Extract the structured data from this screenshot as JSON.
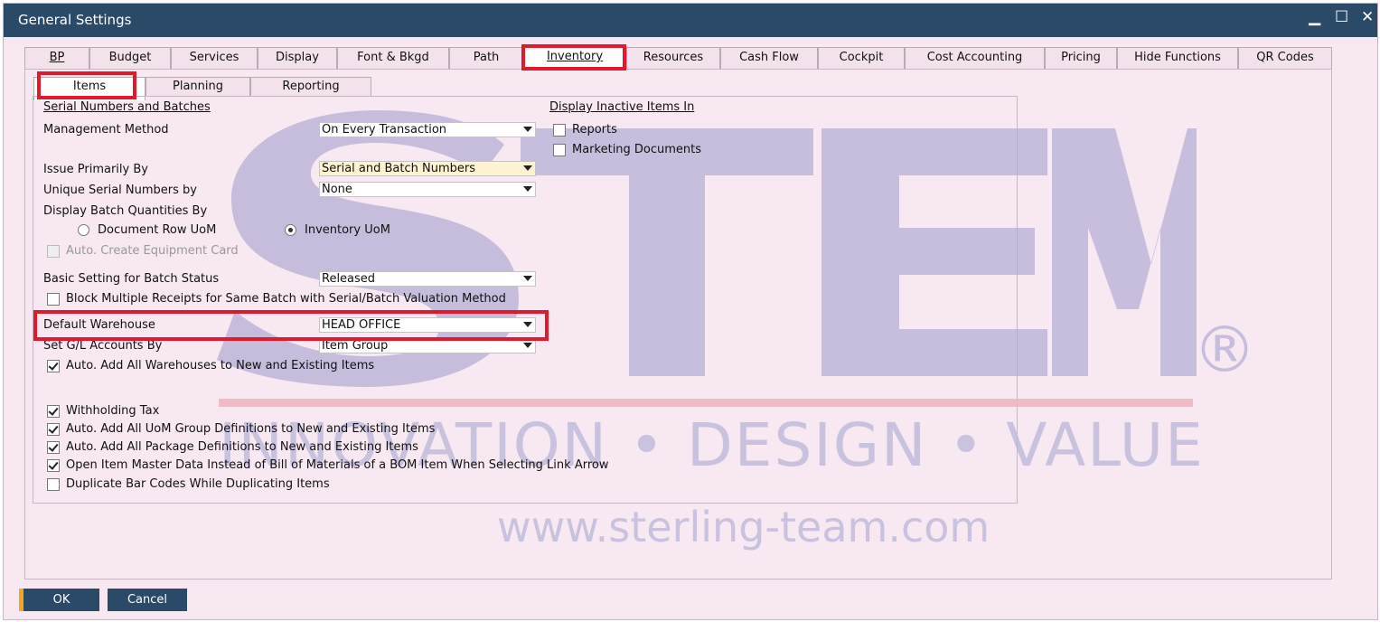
{
  "window": {
    "title": "General Settings",
    "minimize": "▁",
    "maximize": "☐",
    "close": "✕"
  },
  "main_tabs": [
    "BP",
    "Budget",
    "Services",
    "Display",
    "Font & Bkgd",
    "Path",
    "Inventory",
    "Resources",
    "Cash Flow",
    "Cockpit",
    "Cost Accounting",
    "Pricing",
    "Hide Functions",
    "QR Codes"
  ],
  "active_main_tab": "Inventory",
  "sub_tabs": [
    "Items",
    "Planning",
    "Reporting"
  ],
  "active_sub_tab": "Items",
  "items": {
    "serial_section": "Serial Numbers and Batches",
    "management_method_label": "Management Method",
    "management_method_value": "On Every Transaction",
    "issue_primarily_label": "Issue Primarily By",
    "issue_primarily_value": "Serial and Batch Numbers",
    "unique_serial_label": "Unique Serial Numbers by",
    "unique_serial_value": "None",
    "display_batch_label": "Display Batch Quantities By",
    "radio_doc_row": "Document Row UoM",
    "radio_inventory": "Inventory UoM",
    "auto_equipment": "Auto. Create Equipment Card",
    "basic_batch_label": "Basic Setting for Batch Status",
    "basic_batch_value": "Released",
    "block_multiple": "Block Multiple Receipts for Same Batch with Serial/Batch Valuation Method",
    "default_wh_label": "Default Warehouse",
    "default_wh_value": "HEAD OFFICE",
    "set_gl_label": "Set G/L Accounts By",
    "set_gl_value": "Item Group",
    "auto_add_wh": "Auto. Add All Warehouses to New and Existing Items",
    "withholding": "Withholding Tax",
    "auto_uom": "Auto. Add All UoM Group Definitions to New and Existing Items",
    "auto_pkg": "Auto. Add All Package Definitions to New and Existing Items",
    "open_item_master": "Open Item Master Data Instead of Bill of Materials of a BOM Item When Selecting Link Arrow",
    "dup_barcodes": "Duplicate Bar Codes While Duplicating Items",
    "inactive_section": "Display Inactive Items In",
    "reports": "Reports",
    "marketing_docs": "Marketing Documents"
  },
  "watermark": {
    "letters": [
      "S",
      "T",
      "E",
      "M"
    ],
    "registered": "®",
    "tagline": "INNOVATION • DESIGN • VALUE",
    "url": "www.sterling-team.com"
  },
  "buttons": {
    "ok": "OK",
    "cancel": "Cancel"
  }
}
